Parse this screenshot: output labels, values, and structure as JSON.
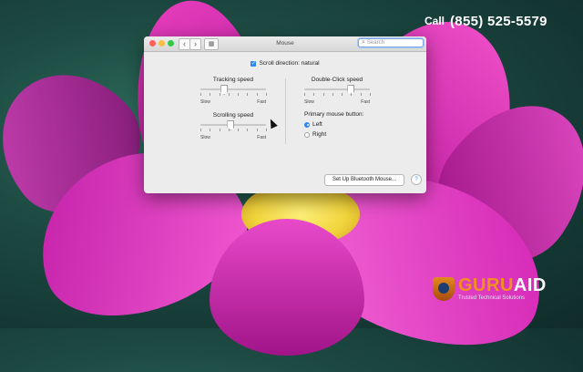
{
  "banner": {
    "call": "Call",
    "number": "(855)  525-5579"
  },
  "logo": {
    "brand_a": "GURU",
    "brand_b": "AID",
    "tagline": "Trusted Technical Solutions"
  },
  "window": {
    "title": "Mouse",
    "search_placeholder": "Search",
    "scroll_direction": {
      "label": "Scroll direction: natural",
      "checked": true
    },
    "tracking": {
      "label": "Tracking speed",
      "min": "Slow",
      "max": "Fast",
      "level": 0.35
    },
    "scrolling": {
      "label": "Scrolling speed",
      "min": "Slow",
      "max": "Fast",
      "level": 0.45
    },
    "double_click": {
      "label": "Double-Click speed",
      "min": "Slow",
      "max": "Fast",
      "level": 0.7
    },
    "primary_button": {
      "label": "Primary mouse button:",
      "options": [
        "Left",
        "Right"
      ],
      "selected": "Left"
    },
    "bluetooth_button": "Set Up Bluetooth Mouse...",
    "help": "?"
  },
  "colors": {
    "accent": "#2f86f6",
    "brand_orange": "#f0901e",
    "brand_navy": "#1d3c73"
  }
}
